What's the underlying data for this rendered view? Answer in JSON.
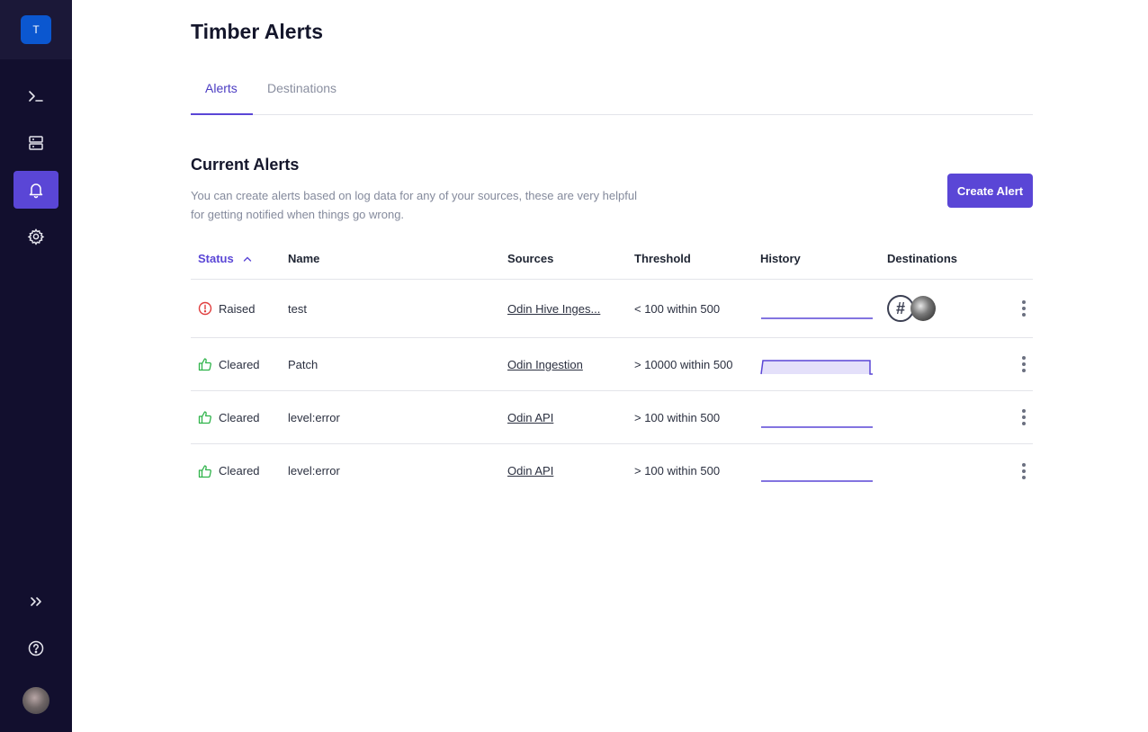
{
  "sidebar": {
    "brand_letter": "T",
    "nav": [
      {
        "name": "terminal-icon"
      },
      {
        "name": "server-icon"
      },
      {
        "name": "bell-icon",
        "active": true
      },
      {
        "name": "gear-icon"
      }
    ],
    "bottom": [
      {
        "name": "chevrons-right-icon"
      },
      {
        "name": "help-icon"
      }
    ]
  },
  "page": {
    "title": "Timber Alerts",
    "tabs": [
      {
        "label": "Alerts",
        "active": true
      },
      {
        "label": "Destinations",
        "active": false
      }
    ]
  },
  "section": {
    "title": "Current Alerts",
    "description": "You can create alerts based on log data for any of your sources, these are very helpful for getting notified when things go wrong.",
    "create_button": "Create Alert"
  },
  "table": {
    "headers": {
      "status": "Status",
      "name": "Name",
      "sources": "Sources",
      "threshold": "Threshold",
      "history": "History",
      "destinations": "Destinations"
    },
    "rows": [
      {
        "status": "Raised",
        "name": "test",
        "source": "Odin Hive Inges...",
        "threshold": "< 100 within 500",
        "history": [
          0,
          0,
          0,
          0,
          0
        ]
      },
      {
        "status": "Cleared",
        "name": "Patch",
        "source": "Odin Ingestion",
        "threshold": "> 10000 within 500",
        "history": [
          0,
          1,
          1,
          1,
          0
        ]
      },
      {
        "status": "Cleared",
        "name": "level:error",
        "source": "Odin API",
        "threshold": "> 100 within 500",
        "history": [
          0,
          0,
          0,
          0,
          0
        ]
      },
      {
        "status": "Cleared",
        "name": "level:error",
        "source": "Odin API",
        "threshold": "> 100 within 500",
        "history": [
          0,
          0,
          0,
          0,
          0
        ]
      }
    ]
  },
  "colors": {
    "accent": "#5a46d6",
    "raised": "#e03e3e",
    "cleared": "#2fb34a",
    "sidebar": "#120f2e"
  }
}
